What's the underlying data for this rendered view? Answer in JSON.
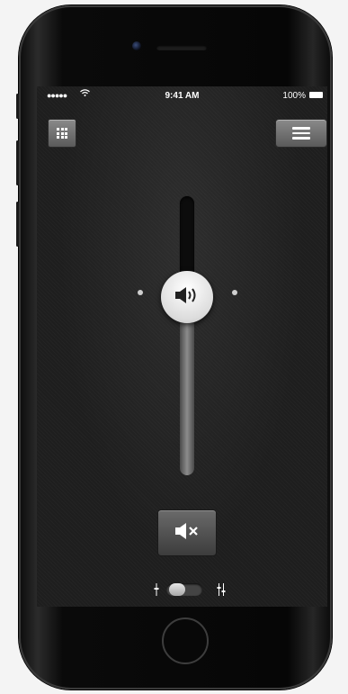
{
  "status_bar": {
    "signal": "●●●●●",
    "time": "9:41 AM",
    "battery": "100%"
  },
  "toolbar": {
    "keypad_icon": "keypad-grid-icon",
    "menu_icon": "hamburger-menu-icon"
  },
  "volume": {
    "level": 0.65,
    "knob_icon": "speaker-on-icon"
  },
  "mute": {
    "icon": "speaker-muted-icon"
  },
  "mode_switch": {
    "left_icon": "mono-icon",
    "right_icon": "stereo-icon",
    "state": "off"
  },
  "colors": {
    "screen_bg": "#1e1e1e",
    "button": "#6e6e6e",
    "knob": "#ececec"
  }
}
